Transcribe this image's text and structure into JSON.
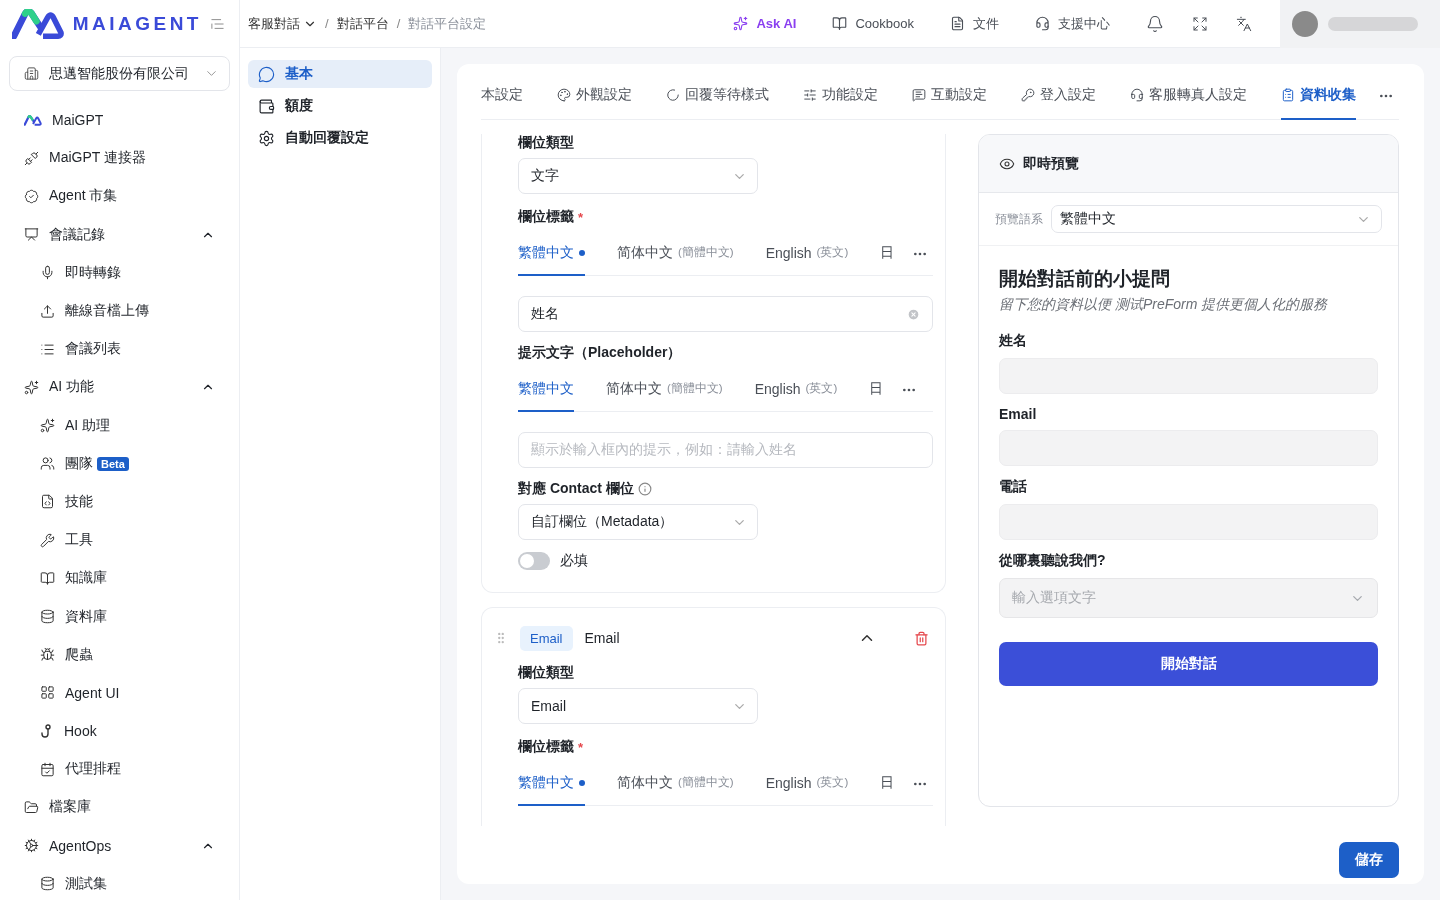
{
  "logo_text": "MAIAGENT",
  "org_select": {
    "value": "思邁智能股份有限公司"
  },
  "sidebar": {
    "items": [
      {
        "label": "MaiGPT"
      },
      {
        "label": "MaiGPT 連接器"
      },
      {
        "label": "Agent 市集"
      },
      {
        "label": "會議記錄",
        "expanded": true,
        "children": [
          {
            "label": "即時轉錄"
          },
          {
            "label": "離線音檔上傳"
          },
          {
            "label": "會議列表"
          }
        ]
      },
      {
        "label": "AI 功能",
        "expanded": true,
        "children": [
          {
            "label": "AI 助理"
          },
          {
            "label": "團隊",
            "badge": "Beta"
          },
          {
            "label": "技能"
          },
          {
            "label": "工具"
          },
          {
            "label": "知識庫"
          },
          {
            "label": "資料庫"
          },
          {
            "label": "爬蟲"
          },
          {
            "label": "Agent UI"
          },
          {
            "label": "Hook"
          },
          {
            "label": "代理排程"
          }
        ]
      },
      {
        "label": "檔案庫"
      },
      {
        "label": "AgentOps",
        "expanded": true,
        "children": [
          {
            "label": "測試集"
          }
        ]
      }
    ]
  },
  "breadcrumb": [
    {
      "label": "客服對話",
      "dropdown": true,
      "current": false,
      "separator": "/"
    },
    {
      "label": "對話平台",
      "dropdown": false,
      "current": false,
      "separator": "/"
    },
    {
      "label": "對話平台設定",
      "dropdown": false,
      "current": true
    }
  ],
  "header_actions": [
    {
      "label": "Ask AI",
      "kind": "ai"
    },
    {
      "label": "Cookbook",
      "kind": "link"
    },
    {
      "label": "文件",
      "kind": "link"
    },
    {
      "label": "支援中心",
      "kind": "link"
    }
  ],
  "subnav": [
    {
      "label": "基本",
      "selected": true
    },
    {
      "label": "額度",
      "selected": false
    },
    {
      "label": "自動回覆設定",
      "selected": false
    }
  ],
  "tabs": [
    {
      "label": "本設定",
      "selected": false
    },
    {
      "label": "外觀設定",
      "selected": false
    },
    {
      "label": "回覆等待樣式",
      "selected": false
    },
    {
      "label": "功能設定",
      "selected": false
    },
    {
      "label": "互動設定",
      "selected": false
    },
    {
      "label": "登入設定",
      "selected": false
    },
    {
      "label": "客服轉真人設定",
      "selected": false
    },
    {
      "label": "資料收集",
      "selected": true
    }
  ],
  "field_cards": [
    {
      "type_label": "欄位類型",
      "type_value": "文字",
      "label_title": "欄位標籤",
      "required_mark": "*",
      "label_langs": [
        {
          "label": "繁體中文",
          "selected": true,
          "filled": true
        },
        {
          "label": "简体中文",
          "note": "(簡體中文)",
          "selected": false,
          "filled": false
        },
        {
          "label": "English",
          "note": "(英文)",
          "selected": false,
          "filled": false
        },
        {
          "label": "日",
          "selected": false,
          "filled": false
        }
      ],
      "label_value": "姓名",
      "placeholder_title": "提示文字（Placeholder）",
      "placeholder_langs": [
        {
          "label": "繁體中文",
          "selected": true,
          "filled": false
        },
        {
          "label": "简体中文",
          "note": "(簡體中文)",
          "selected": false,
          "filled": false
        },
        {
          "label": "English",
          "note": "(英文)",
          "selected": false,
          "filled": false
        },
        {
          "label": "日",
          "selected": false,
          "filled": false
        }
      ],
      "placeholder_hint": "顯示於輸入框內的提示，例如：請輸入姓名",
      "contact_title": "對應 Contact 欄位",
      "contact_value": "自訂欄位（Metadata）",
      "required_toggle": {
        "label": "必填",
        "on": false
      }
    },
    {
      "tag": "Email",
      "title": "Email",
      "expanded": true,
      "type_label": "欄位類型",
      "type_value": "Email",
      "label_title": "欄位標籤",
      "required_mark": "*",
      "label_langs": [
        {
          "label": "繁體中文",
          "selected": true,
          "filled": true
        },
        {
          "label": "简体中文",
          "note": "(簡體中文)",
          "selected": false,
          "filled": false
        },
        {
          "label": "English",
          "note": "(英文)",
          "selected": false,
          "filled": false
        },
        {
          "label": "日",
          "selected": false,
          "filled": false
        }
      ]
    }
  ],
  "preview": {
    "title": "即時預覽",
    "lang_label": "預覽語系",
    "lang_value": "繁體中文",
    "form_title": "開始對話前的小提問",
    "form_subtitle": "留下您的資料以便 测试PreForm 提供更個人化的服務",
    "fields": [
      {
        "label": "姓名",
        "kind": "text"
      },
      {
        "label": "Email",
        "kind": "text"
      },
      {
        "label": "電話",
        "kind": "text"
      },
      {
        "label": "從哪裏聽說我們?",
        "kind": "select",
        "placeholder": "輸入選項文字"
      }
    ],
    "submit": "開始對話"
  },
  "save_button": "儲存"
}
